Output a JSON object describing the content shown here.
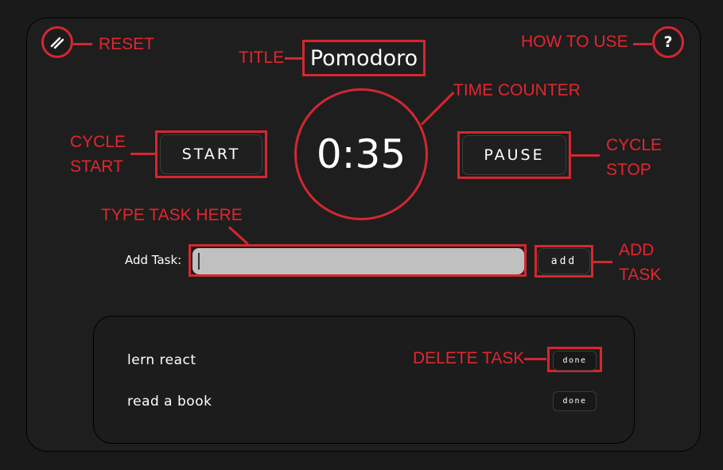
{
  "app": {
    "title": "Pomodoro",
    "timer": "0:35"
  },
  "buttons": {
    "start": "START",
    "pause": "PAUSE",
    "add": "add",
    "reset_icon": "double-slash-icon",
    "help_icon": "?"
  },
  "task_input": {
    "label": "Add Task:",
    "value": ""
  },
  "tasks": [
    {
      "text": "lern react",
      "action": "done"
    },
    {
      "text": "read a book",
      "action": "done"
    }
  ],
  "annotations": {
    "reset": "RESET",
    "title": "TITLE",
    "how_to_use": "HOW TO USE",
    "time_counter": "TIME COUNTER",
    "cycle_start_1": "CYCLE",
    "cycle_start_2": "START",
    "cycle_stop_1": "CYCLE",
    "cycle_stop_2": "STOP",
    "type_task": "TYPE TASK HERE",
    "add_task_1": "ADD",
    "add_task_2": "TASK",
    "delete_task": "DELETE TASK"
  },
  "colors": {
    "annotation": "#e3262f",
    "background": "#1a1a1a",
    "input": "#c0c0c0"
  }
}
